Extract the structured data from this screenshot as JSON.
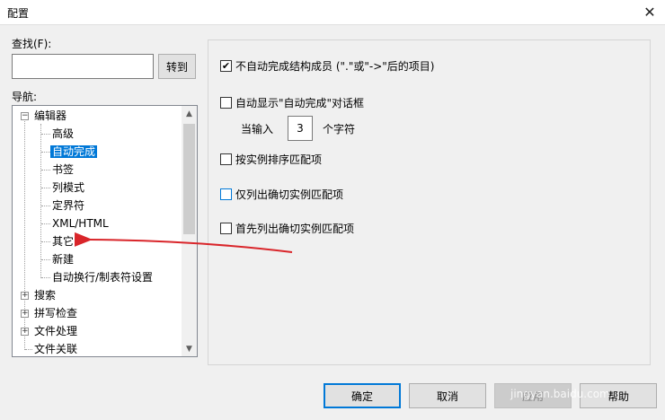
{
  "window": {
    "title": "配置"
  },
  "find": {
    "label": "查找(F):",
    "value": "",
    "goto_button": "转到"
  },
  "nav": {
    "label": "导航:",
    "editor": "编辑器",
    "editor_children": [
      "高级",
      "自动完成",
      "书签",
      "列模式",
      "定界符",
      "XML/HTML",
      "其它",
      "新建",
      "自动换行/制表符设置"
    ],
    "selected": "自动完成",
    "search": "搜索",
    "spellcheck": "拼写检查",
    "file_handling": "文件处理",
    "file_assoc": "文件关联"
  },
  "options": {
    "auto_complete_structure": "不自动完成结构成员 (\".\"或\"->\"后的项目)",
    "auto_show_dialog": "自动显示\"自动完成\"对话框",
    "when_typing": "当输入",
    "char_count": "3",
    "chars_suffix": "个字符",
    "sort_by_instance": "按实例排序匹配项",
    "list_exact_only": "仅列出确切实例匹配项",
    "list_exact_first": "首先列出确切实例匹配项"
  },
  "buttons": {
    "ok": "确定",
    "cancel": "取消",
    "apply": "应用",
    "help": "帮助"
  },
  "watermark": "jingyan.baidu.com"
}
